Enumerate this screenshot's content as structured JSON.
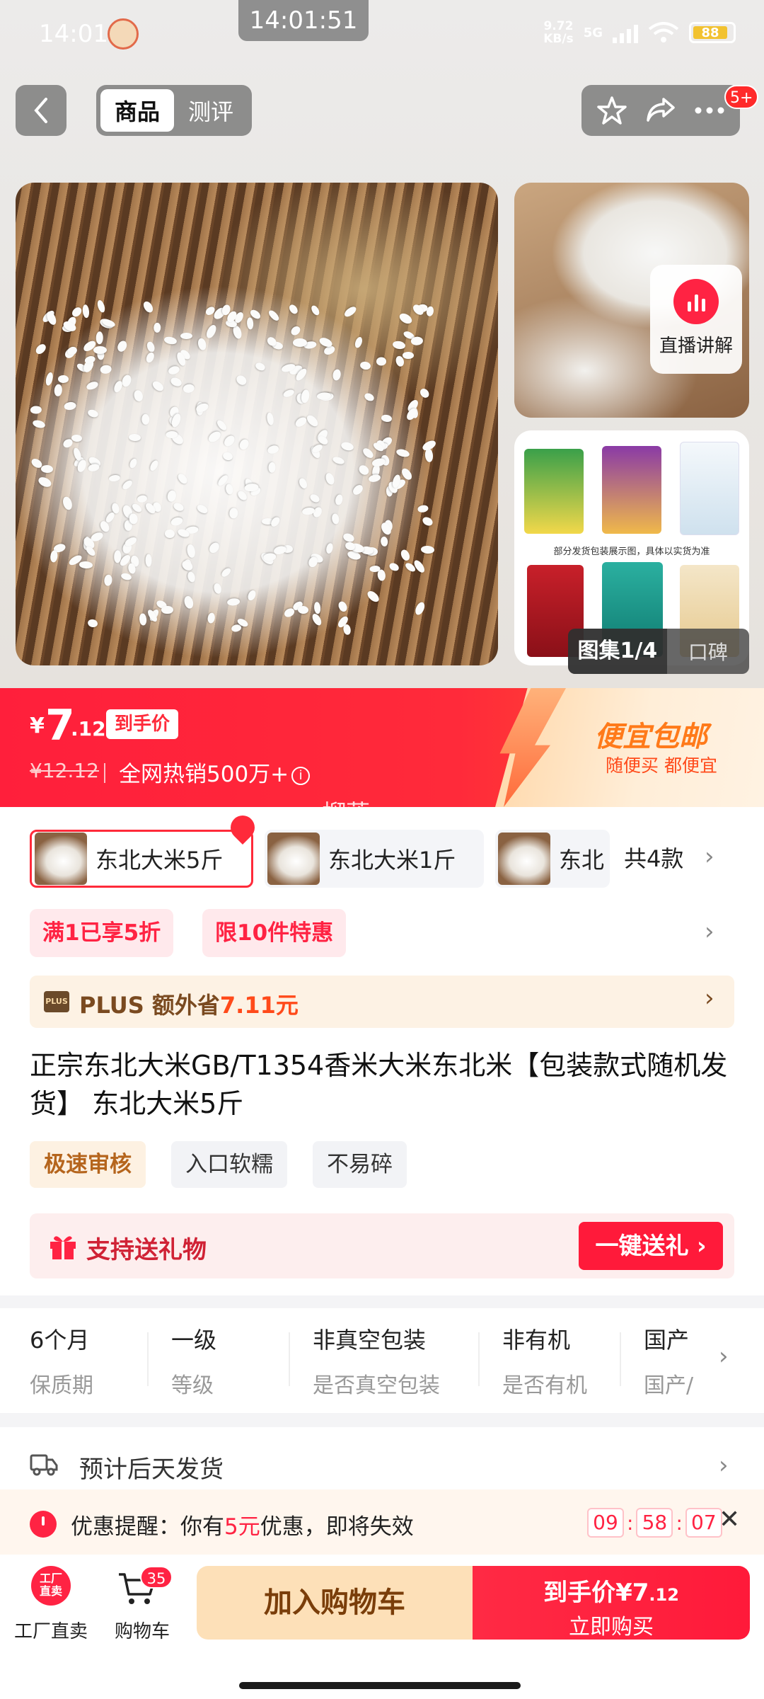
{
  "status_bar": {
    "time": "14:01",
    "center_time": "14:01:51",
    "network_speed": "9.72\nKB/s",
    "network_type": "5G",
    "battery": "88"
  },
  "nav": {
    "tabs": [
      {
        "label": "商品",
        "active": true
      },
      {
        "label": "测评",
        "active": false
      }
    ],
    "more_badge": "5+"
  },
  "gallery": {
    "live_label": "直播讲解",
    "pack_caption": "部分发货包装展示图，具体以实货为准",
    "album_label": "图集1/4",
    "reviews_label": "口碑"
  },
  "price": {
    "currency": "¥",
    "integer": "7",
    "decimal": ".12",
    "tag": "到手价",
    "original": "¥12.12",
    "sales": "全网热销500万+",
    "promo_title": "便宜包邮",
    "promo_sub": "随便买 都便宜"
  },
  "watermark": "榴莲_",
  "variants": {
    "items": [
      {
        "label": "东北大米5斤",
        "selected": true
      },
      {
        "label": "东北大米1斤",
        "selected": false
      },
      {
        "label": "东北",
        "selected": false
      }
    ],
    "count": "共4款"
  },
  "promos": [
    "满1已享5折",
    "限10件特惠"
  ],
  "plus": {
    "logo": "PLUS",
    "text": "PLUS 额外省",
    "amount": "7.11元"
  },
  "product_title": "正宗东北大米GB/T1354香米大米东北米【包装款式随机发货】 东北大米5斤",
  "tags": [
    "极速审核",
    "入口软糯",
    "不易碎"
  ],
  "gift": {
    "label": "支持送礼物",
    "button": "一键送礼"
  },
  "specs": [
    {
      "value": "6个月",
      "key": "保质期"
    },
    {
      "value": "一级",
      "key": "等级"
    },
    {
      "value": "非真空包装",
      "key": "是否真空包装"
    },
    {
      "value": "非有机",
      "key": "是否有机"
    },
    {
      "value": "国产",
      "key": "国产/"
    }
  ],
  "shipping": "预计后天发货",
  "reminder": {
    "prefix": "优惠提醒：你有",
    "amount": "5元",
    "suffix": "优惠，即将失效",
    "timer": [
      "09",
      "58",
      "07"
    ]
  },
  "bottom": {
    "factory_icon": "工厂直卖",
    "factory_label": "工厂直卖",
    "cart_badge": "35",
    "cart_label": "购物车",
    "add_to_cart": "加入购物车",
    "buy_price_prefix": "到手价¥7",
    "buy_price_decimal": ".12",
    "buy_label": "立即购买"
  },
  "colors": {
    "accent_red": "#ff2343",
    "gold_text": "#b5651d"
  }
}
